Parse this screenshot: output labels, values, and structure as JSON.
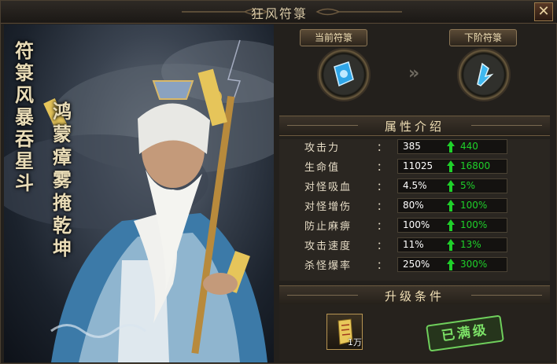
{
  "window": {
    "title": "狂风符箓",
    "close_label": "✕"
  },
  "art": {
    "title_lines": [
      "符箓风暴吞星斗",
      "鸿蒙瘴雾掩乾坤"
    ]
  },
  "upgrade_panel": {
    "current_label": "当前符箓",
    "next_label": "下阶符箓",
    "arrow": "»"
  },
  "attributes": {
    "heading": "属性介绍",
    "rows": [
      {
        "label": "攻击力",
        "current": "385",
        "next": "440"
      },
      {
        "label": "生命值",
        "current": "11025",
        "next": "16800"
      },
      {
        "label": "对怪吸血",
        "current": "4.5%",
        "next": "5%"
      },
      {
        "label": "对怪增伤",
        "current": "80%",
        "next": "100%"
      },
      {
        "label": "防止麻痹",
        "current": "100%",
        "next": "100%"
      },
      {
        "label": "攻击速度",
        "current": "11%",
        "next": "13%"
      },
      {
        "label": "杀怪爆率",
        "current": "250%",
        "next": "300%"
      }
    ],
    "colon": "："
  },
  "conditions": {
    "heading": "升级条件",
    "item_count": "1万",
    "status_stamp": "已满级"
  },
  "colors": {
    "up_green": "#1fd12a",
    "gold": "#c8a868"
  },
  "icons": {
    "close": "close-icon",
    "current_talisman": "blue-talisman-icon",
    "next_talisman": "blue-crystal-talisman-icon",
    "up": "up-arrow-icon",
    "item": "yellow-scroll-icon"
  }
}
